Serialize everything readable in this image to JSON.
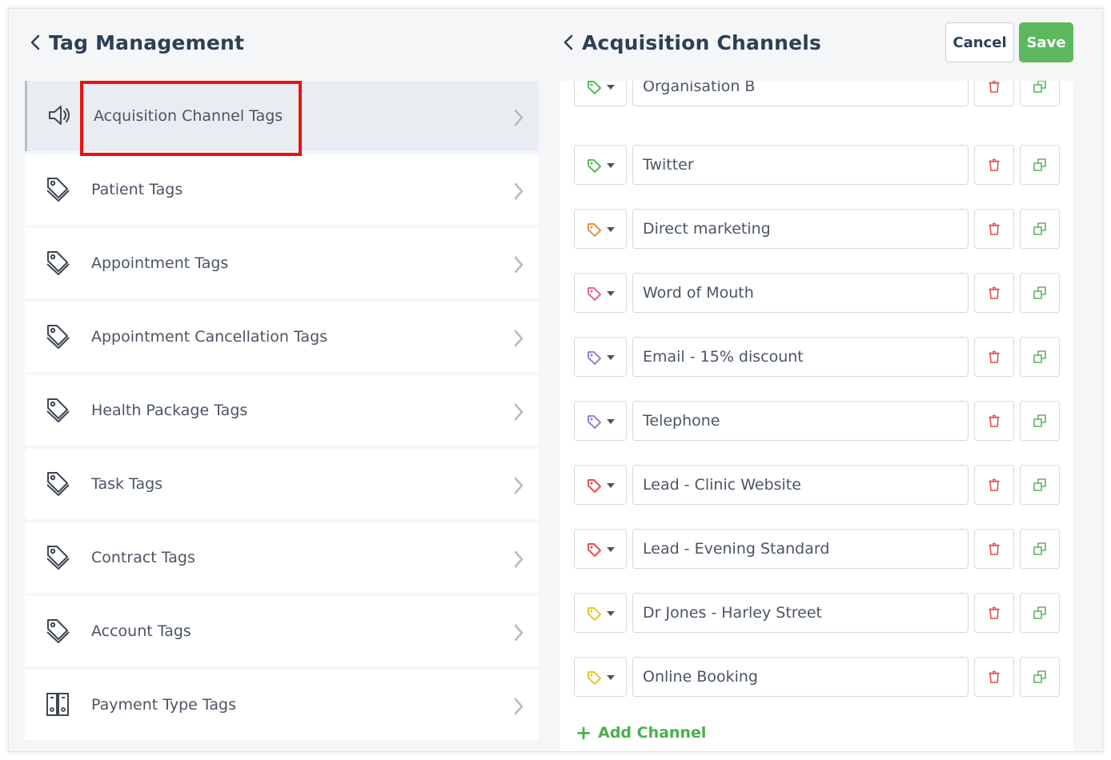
{
  "left_panel": {
    "title": "Tag Management",
    "items": [
      {
        "label": "Acquisition Channel Tags",
        "icon": "megaphone-icon",
        "active": true
      },
      {
        "label": "Patient Tags",
        "icon": "tags-icon"
      },
      {
        "label": "Appointment Tags",
        "icon": "tags-icon"
      },
      {
        "label": "Appointment Cancellation Tags",
        "icon": "tags-icon"
      },
      {
        "label": "Health Package Tags",
        "icon": "tags-icon"
      },
      {
        "label": "Task Tags",
        "icon": "tags-icon"
      },
      {
        "label": "Contract Tags",
        "icon": "tags-icon"
      },
      {
        "label": "Account Tags",
        "icon": "tags-icon"
      },
      {
        "label": "Payment Type Tags",
        "icon": "binders-icon"
      }
    ]
  },
  "right_panel": {
    "title": "Acquisition Channels",
    "cancel_label": "Cancel",
    "save_label": "Save",
    "add_channel_label": "Add Channel",
    "channels": [
      {
        "name": "Organisation B",
        "color": "#5cb85c"
      },
      {
        "name": "Twitter",
        "color": "#5cb85c"
      },
      {
        "name": "Direct marketing",
        "color": "#e8914a"
      },
      {
        "name": "Word of Mouth",
        "color": "#e0679a"
      },
      {
        "name": "Email - 15% discount",
        "color": "#9b7fd4"
      },
      {
        "name": "Telephone",
        "color": "#9b7fd4"
      },
      {
        "name": "Lead - Clinic Website",
        "color": "#e05050"
      },
      {
        "name": "Lead - Evening Standard",
        "color": "#e05050"
      },
      {
        "name": "Dr Jones - Harley Street",
        "color": "#e3c62b"
      },
      {
        "name": "Online Booking",
        "color": "#e3c62b"
      }
    ]
  },
  "colors": {
    "accent_green": "#5cb85c",
    "delete_red": "#e05050",
    "highlight_red": "#ee1111",
    "heading": "#2d3f55"
  }
}
